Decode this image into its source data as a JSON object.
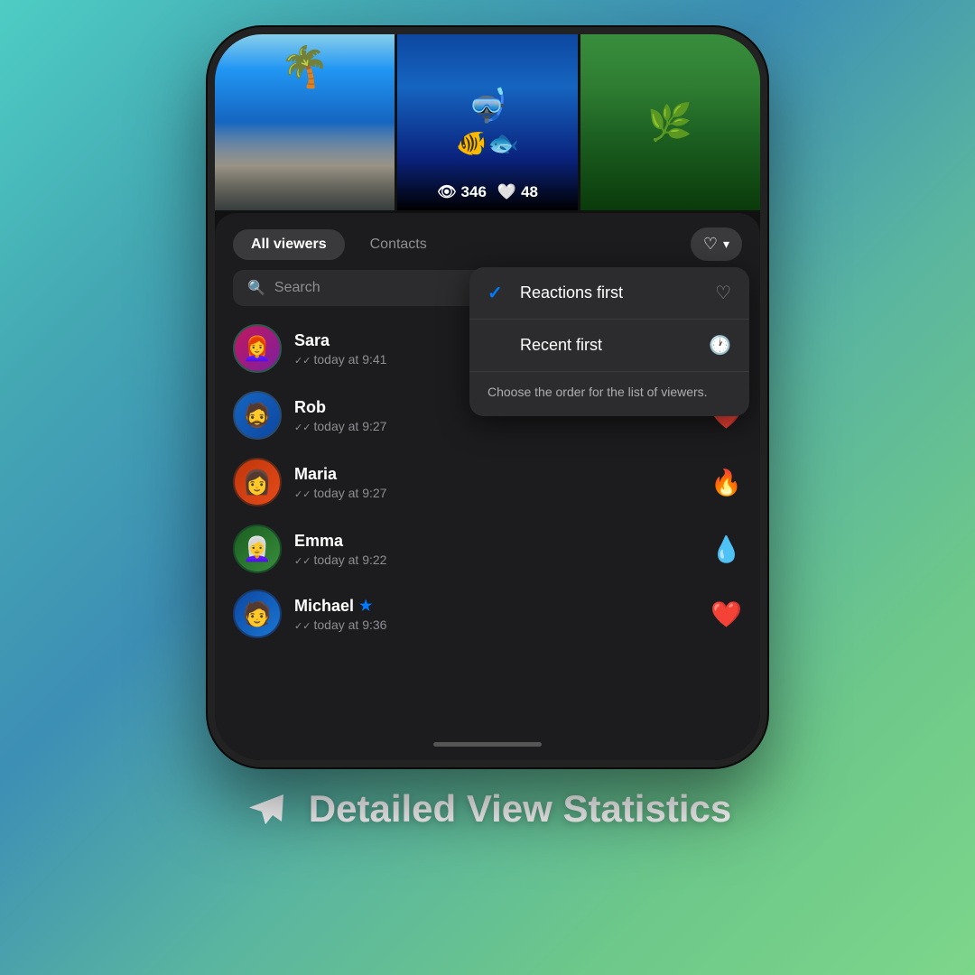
{
  "background": {
    "gradient_start": "#4ecdc4",
    "gradient_end": "#7dd68a"
  },
  "phone": {
    "photos": [
      {
        "type": "beach",
        "label": "Beach with palms"
      },
      {
        "type": "ocean",
        "label": "Underwater diving"
      },
      {
        "type": "tropical",
        "label": "Tropical island"
      }
    ],
    "stats": {
      "views_icon": "👁",
      "views_count": "346",
      "likes_icon": "🤍",
      "likes_count": "48"
    },
    "tabs": [
      {
        "id": "all",
        "label": "All viewers",
        "active": true
      },
      {
        "id": "contacts",
        "label": "Contacts",
        "active": false
      }
    ],
    "sort_button": {
      "icon": "♡",
      "chevron": "▾"
    },
    "search": {
      "placeholder": "Search",
      "icon": "🔍"
    },
    "viewers": [
      {
        "id": "sara",
        "name": "Sara",
        "time": "today at 9:41",
        "reaction": null,
        "avatar_emoji": "👩"
      },
      {
        "id": "rob",
        "name": "Rob",
        "time": "today at 9:27",
        "reaction": "❤️",
        "avatar_emoji": "🧔"
      },
      {
        "id": "maria",
        "name": "Maria",
        "time": "today at 9:27",
        "reaction": "🔥",
        "avatar_emoji": "👩"
      },
      {
        "id": "emma",
        "name": "Emma",
        "time": "today at 9:22",
        "reaction": "💧",
        "avatar_emoji": "👩"
      },
      {
        "id": "michael",
        "name": "Michael",
        "time": "today at 9:36",
        "reaction": "❤️",
        "has_star": true,
        "avatar_emoji": "👨"
      }
    ],
    "dropdown": {
      "items": [
        {
          "id": "reactions-first",
          "label": "Reactions first",
          "icon": "♡",
          "checked": true
        },
        {
          "id": "recent-first",
          "label": "Recent first",
          "icon": "🕐",
          "checked": false
        }
      ],
      "info_text": "Choose the order for the list of viewers."
    }
  },
  "footer": {
    "icon": "✈",
    "title": "Detailed View Statistics"
  }
}
